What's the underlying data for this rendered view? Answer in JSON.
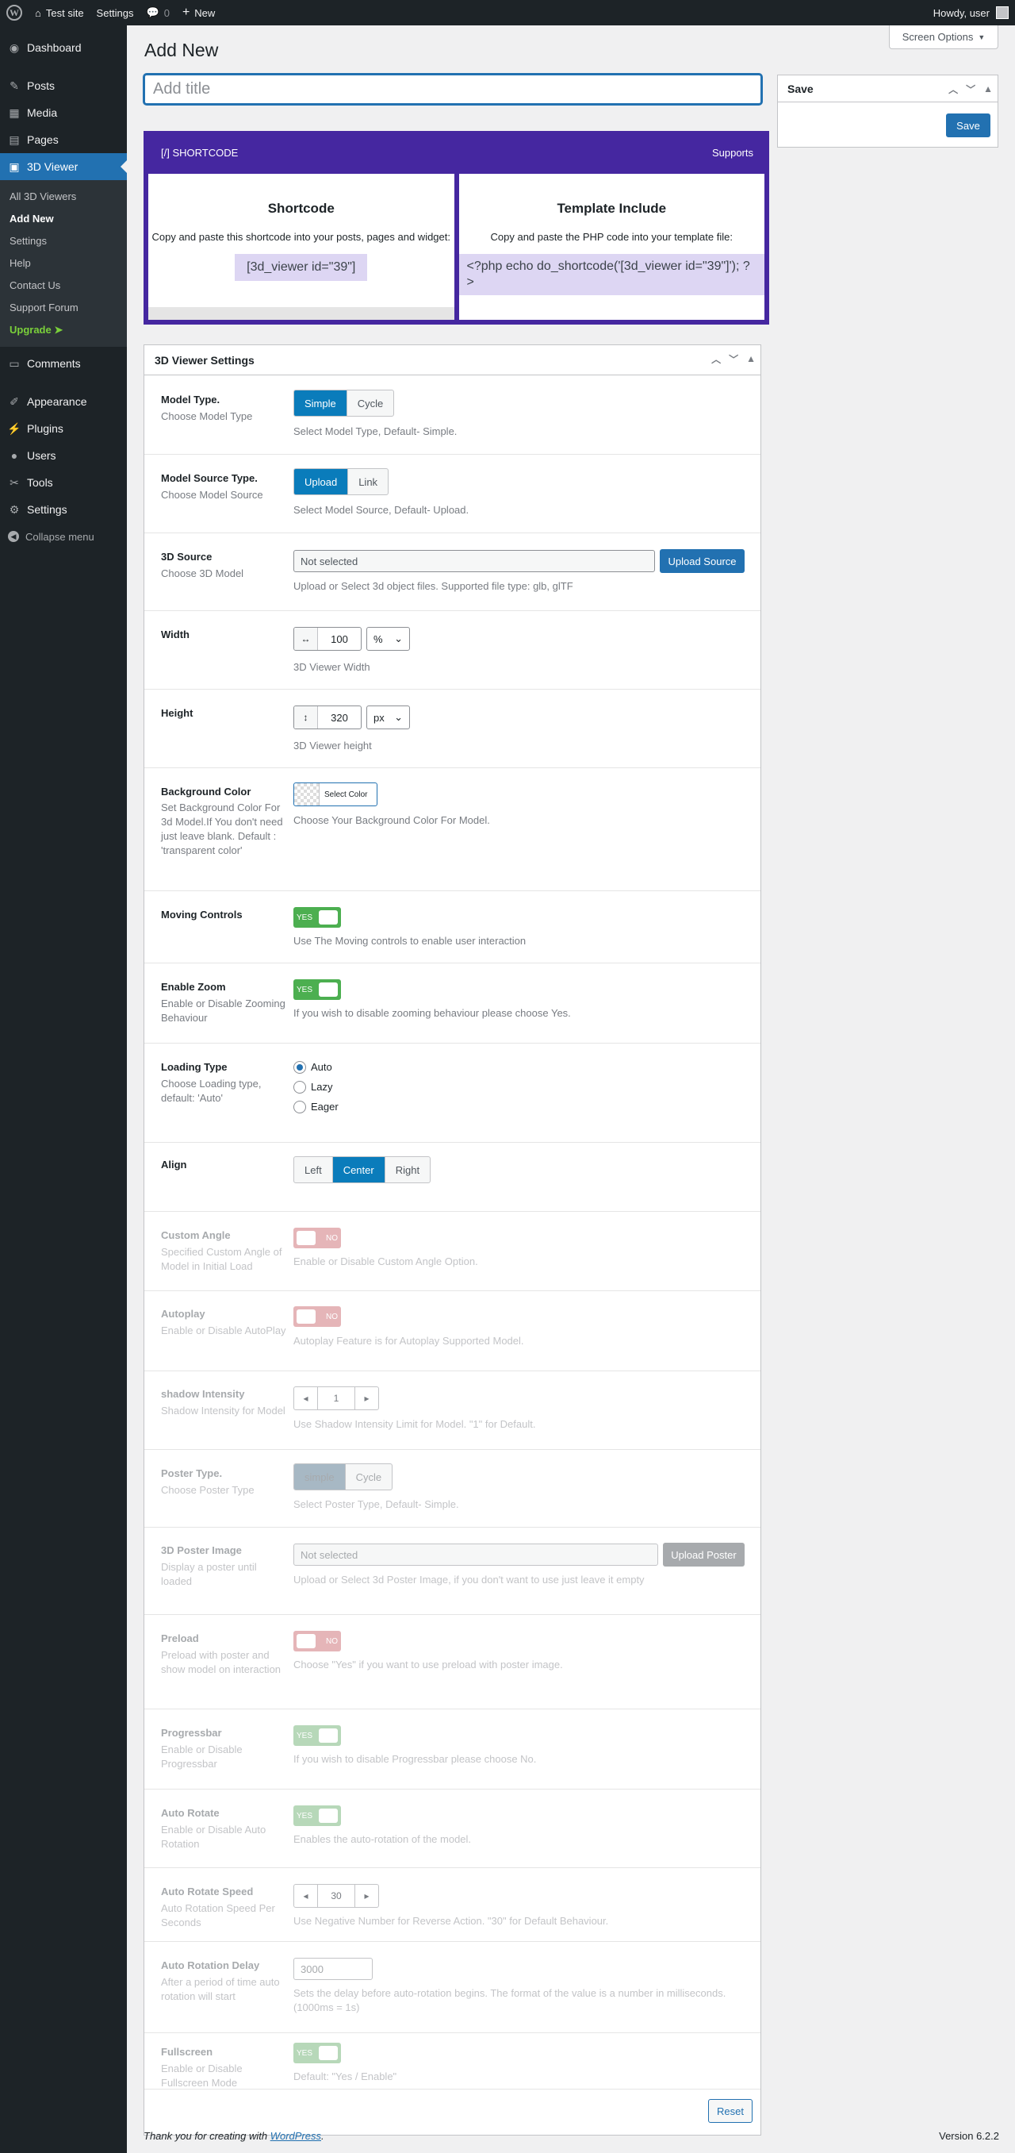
{
  "adminbar": {
    "site_name": "Test site",
    "settings": "Settings",
    "comments_count": "0",
    "new": "New",
    "howdy": "Howdy, user"
  },
  "sidebar": {
    "items": [
      {
        "label": "Dashboard",
        "icon": "dashboard-icon"
      },
      {
        "label": "Posts",
        "icon": "pin-icon"
      },
      {
        "label": "Media",
        "icon": "media-icon"
      },
      {
        "label": "Pages",
        "icon": "pages-icon"
      },
      {
        "label": "3D Viewer",
        "icon": "viewer-icon"
      }
    ],
    "submenu": [
      "All 3D Viewers",
      "Add New",
      "Settings",
      "Help",
      "Contact Us",
      "Support Forum",
      "Upgrade ➤"
    ],
    "items2": [
      {
        "label": "Comments",
        "icon": "comments-icon"
      },
      {
        "label": "Appearance",
        "icon": "brush-icon"
      },
      {
        "label": "Plugins",
        "icon": "plugin-icon"
      },
      {
        "label": "Users",
        "icon": "users-icon"
      },
      {
        "label": "Tools",
        "icon": "wrench-icon"
      },
      {
        "label": "Settings",
        "icon": "settings-icon"
      }
    ],
    "collapse": "Collapse menu"
  },
  "screen_options": "Screen Options",
  "page_title": "Add New",
  "title_placeholder": "Add title",
  "savebox": {
    "title": "Save",
    "button": "Save"
  },
  "shortcode_box": {
    "logo": "[/] SHORTCODE",
    "supports": "Supports",
    "shortcode": {
      "title": "Shortcode",
      "text": "Copy and paste this shortcode into your posts, pages and widget:",
      "code": "[3d_viewer id=\"39\"]"
    },
    "template": {
      "title": "Template Include",
      "text": "Copy and paste the PHP code into your template file:",
      "code": "<?php echo do_shortcode('[3d_viewer id=\"39\"]'); ?>"
    }
  },
  "settings": {
    "title": "3D Viewer Settings",
    "model_type": {
      "label": "Model Type.",
      "desc": "Choose Model Type",
      "options": [
        "Simple",
        "Cycle"
      ],
      "help": "Select Model Type, Default- Simple."
    },
    "model_source": {
      "label": "Model Source Type.",
      "desc": "Choose Model Source",
      "options": [
        "Upload",
        "Link"
      ],
      "help": "Select Model Source, Default- Upload."
    },
    "source": {
      "label": "3D Source",
      "desc": "Choose 3D Model",
      "value": "Not selected",
      "button": "Upload Source",
      "help": "Upload or Select 3d object files. Supported file type: glb, glTF"
    },
    "width": {
      "label": "Width",
      "value": "100",
      "unit": "%",
      "help": "3D Viewer Width"
    },
    "height": {
      "label": "Height",
      "value": "320",
      "unit": "px",
      "help": "3D Viewer height"
    },
    "bg_color": {
      "label": "Background Color",
      "desc": "Set Background Color For 3d Model.If You don't need just leave blank. Default : 'transparent color'",
      "button": "Select Color",
      "help": "Choose Your Background Color For Model."
    },
    "moving": {
      "label": "Moving Controls",
      "state": "YES",
      "help": "Use The Moving controls to enable user interaction"
    },
    "zoom": {
      "label": "Enable Zoom",
      "desc": "Enable or Disable Zooming Behaviour",
      "state": "YES",
      "help": "If you wish to disable zooming behaviour please choose Yes."
    },
    "loading": {
      "label": "Loading Type",
      "desc": "Choose Loading type, default: 'Auto'",
      "options": [
        "Auto",
        "Lazy",
        "Eager"
      ]
    },
    "align": {
      "label": "Align",
      "options": [
        "Left",
        "Center",
        "Right"
      ]
    },
    "custom_angle": {
      "label": "Custom Angle",
      "desc": "Specified Custom Angle of Model in Initial Load",
      "state": "NO",
      "help": "Enable or Disable Custom Angle Option."
    },
    "autoplay": {
      "label": "Autoplay",
      "desc": "Enable or Disable AutoPlay",
      "state": "NO",
      "help": "Autoplay Feature is for Autoplay Supported Model."
    },
    "shadow": {
      "label": "shadow Intensity",
      "desc": "Shadow Intensity for Model",
      "value": "1",
      "help": "Use Shadow Intensity Limit for Model. \"1\" for Default."
    },
    "poster_type": {
      "label": "Poster Type.",
      "desc": "Choose Poster Type",
      "options": [
        "simple",
        "Cycle"
      ],
      "help": "Select Poster Type, Default- Simple."
    },
    "poster_image": {
      "label": "3D Poster Image",
      "desc": "Display a poster until loaded",
      "value": "Not selected",
      "button": "Upload Poster",
      "help": "Upload or Select 3d Poster Image, if you don't want to use just leave it empty"
    },
    "preload": {
      "label": "Preload",
      "desc": "Preload with poster and show model on interaction",
      "state": "NO",
      "help": "Choose \"Yes\" if you want to use preload with poster image."
    },
    "progressbar": {
      "label": "Progressbar",
      "desc": "Enable or Disable Progressbar",
      "state": "YES",
      "help": "If you wish to disable Progressbar please choose No."
    },
    "auto_rotate": {
      "label": "Auto Rotate",
      "desc": "Enable or Disable Auto Rotation",
      "state": "YES",
      "help": "Enables the auto-rotation of the model."
    },
    "rotate_speed": {
      "label": "Auto Rotate Speed",
      "desc": "Auto Rotation Speed Per Seconds",
      "value": "30",
      "help": "Use Negative Number for Reverse Action. \"30\" for Default Behaviour."
    },
    "rotation_delay": {
      "label": "Auto Rotation Delay",
      "desc": "After a period of time auto rotation will start",
      "value": "3000",
      "help": "Sets the delay before auto-rotation begins. The format of the value is a number in milliseconds.(1000ms = 1s)"
    },
    "fullscreen": {
      "label": "Fullscreen",
      "desc": "Enable or Disable Fullscreen Mode",
      "state": "YES",
      "help": "Default: \"Yes / Enable\""
    },
    "reset": "Reset"
  },
  "footer": {
    "thanks": "Thank you for creating with",
    "link": "WordPress",
    "version": "Version 6.2.2"
  }
}
